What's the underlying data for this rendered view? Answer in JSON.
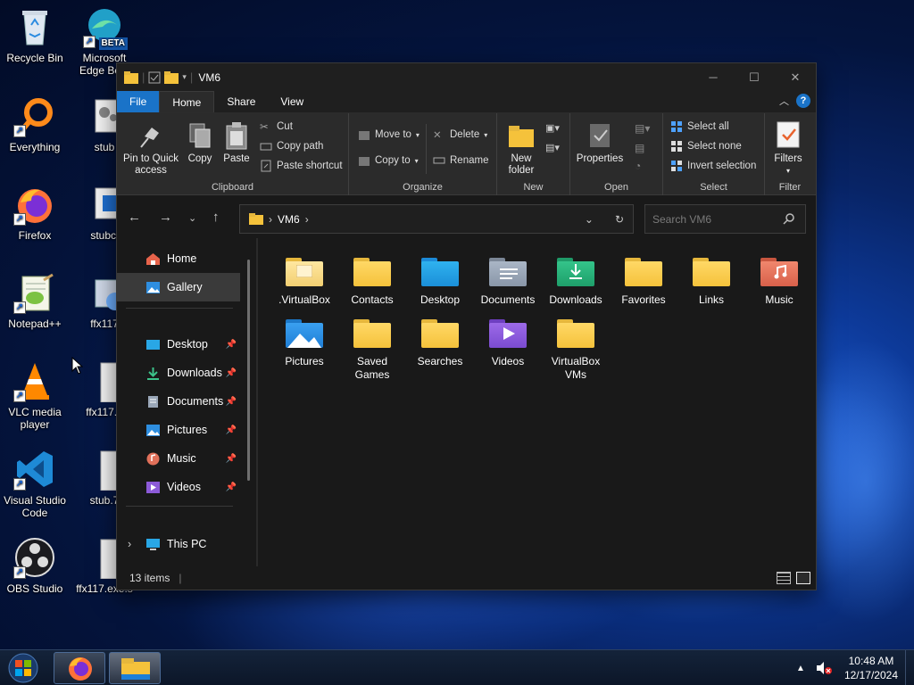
{
  "desktop": {
    "icons": [
      {
        "label": "Recycle Bin"
      },
      {
        "label": "Microsoft Edge Be...",
        "badge": "BETA"
      },
      {
        "label": "Everything"
      },
      {
        "label": "stub"
      },
      {
        "label": "Firefox"
      },
      {
        "label": "stubcl"
      },
      {
        "label": "Notepad++"
      },
      {
        "label": "ffx117"
      },
      {
        "label": "VLC media player"
      },
      {
        "label": "ffx117.e"
      },
      {
        "label": "Visual Studio Code"
      },
      {
        "label": "stub.7"
      },
      {
        "label": "OBS Studio"
      },
      {
        "label": "ffx117.exe.s"
      }
    ]
  },
  "window": {
    "title": "VM6",
    "tabs": {
      "file": "File",
      "home": "Home",
      "share": "Share",
      "view": "View"
    },
    "ribbon": {
      "clipboard": {
        "name": "Clipboard",
        "pin": "Pin to Quick access",
        "copy": "Copy",
        "paste": "Paste",
        "cut": "Cut",
        "copy_path": "Copy path",
        "paste_shortcut": "Paste shortcut"
      },
      "organize": {
        "name": "Organize",
        "move_to": "Move to",
        "copy_to": "Copy to",
        "delete": "Delete",
        "rename": "Rename"
      },
      "new": {
        "name": "New",
        "new_folder": "New folder"
      },
      "open": {
        "name": "Open",
        "properties": "Properties"
      },
      "select": {
        "name": "Select",
        "select_all": "Select all",
        "select_none": "Select none",
        "invert": "Invert selection"
      },
      "filter": {
        "name": "Filter",
        "filters": "Filters"
      }
    },
    "address": {
      "path": "VM6"
    },
    "search": {
      "placeholder": "Search VM6"
    },
    "navpane": {
      "home": "Home",
      "gallery": "Gallery",
      "pinned": [
        "Desktop",
        "Downloads",
        "Documents",
        "Pictures",
        "Music",
        "Videos"
      ],
      "this_pc": "This PC"
    },
    "items": [
      ".VirtualBox",
      "Contacts",
      "Desktop",
      "Documents",
      "Downloads",
      "Favorites",
      "Links",
      "Music",
      "Pictures",
      "Saved Games",
      "Searches",
      "Videos",
      "VirtualBox VMs"
    ],
    "status": {
      "count": "13 items"
    }
  },
  "taskbar": {
    "time": "10:48 AM",
    "date": "12/17/2024"
  },
  "colors": {
    "accent": "#1a73c8",
    "folder": "#f5c23b",
    "window_bg": "#191919",
    "ribbon_bg": "#2b2b2b"
  }
}
